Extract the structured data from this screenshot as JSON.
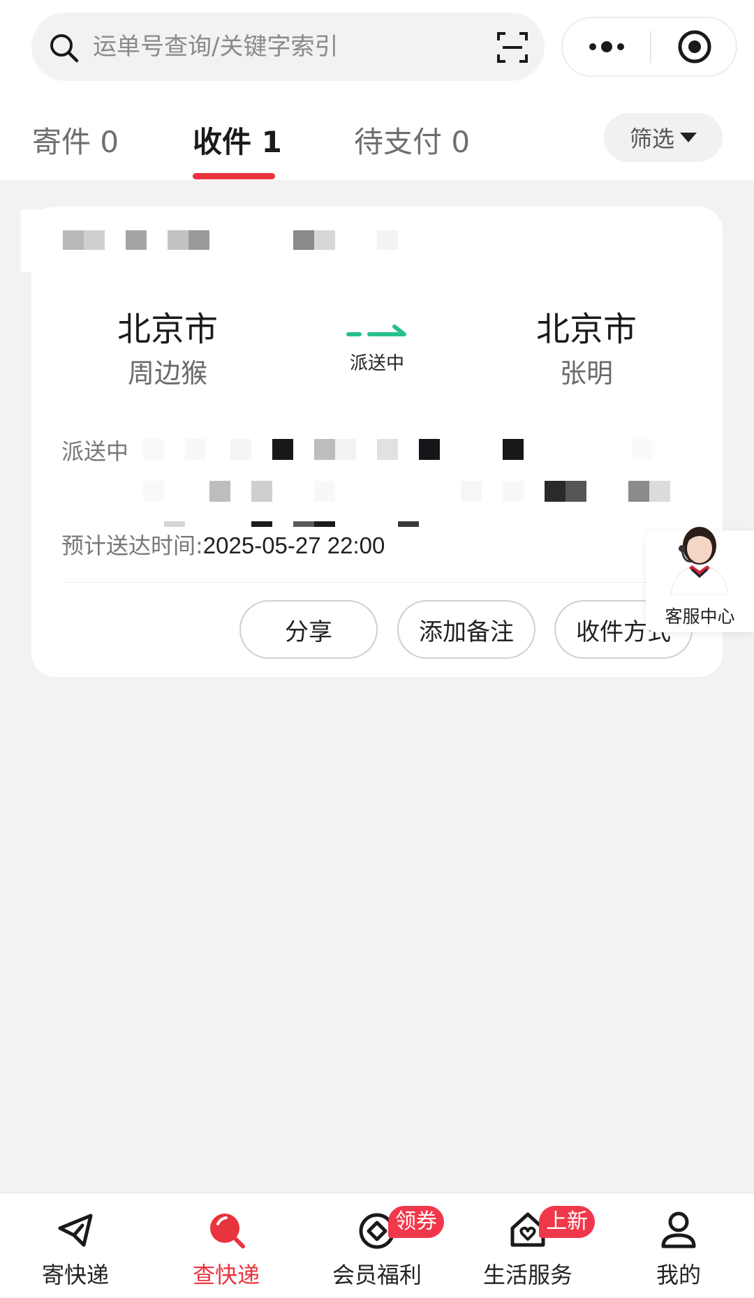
{
  "search": {
    "placeholder": "运单号查询/关键字索引"
  },
  "tabs": [
    {
      "label": "寄件 0",
      "active": false
    },
    {
      "label": "收件 1",
      "active": true
    },
    {
      "label": "待支付 0",
      "active": false
    }
  ],
  "filter": {
    "label": "筛选"
  },
  "card": {
    "from": {
      "city": "北京市",
      "name": "周边猴"
    },
    "to": {
      "city": "北京市",
      "name": "张明"
    },
    "route_status": "派送中",
    "status_label": "派送中",
    "eta_label": "预计送达时间:",
    "eta_value": "2025-05-27 22:00",
    "actions": [
      "分享",
      "添加备注",
      "收件方式"
    ]
  },
  "customer_service": {
    "label": "客服中心"
  },
  "bottom_nav": [
    {
      "label": "寄快递",
      "icon": "send-paper-plane-icon",
      "active": false
    },
    {
      "label": "查快递",
      "icon": "search-package-icon",
      "active": true
    },
    {
      "label": "会员福利",
      "icon": "member-coin-icon",
      "active": false,
      "badge": "领券"
    },
    {
      "label": "生活服务",
      "icon": "home-heart-icon",
      "active": false,
      "badge": "上新"
    },
    {
      "label": "我的",
      "icon": "user-profile-icon",
      "active": false
    }
  ],
  "colors": {
    "accent": "#e8343d",
    "route_green": "#27c08a",
    "background": "#f2f2f2"
  }
}
